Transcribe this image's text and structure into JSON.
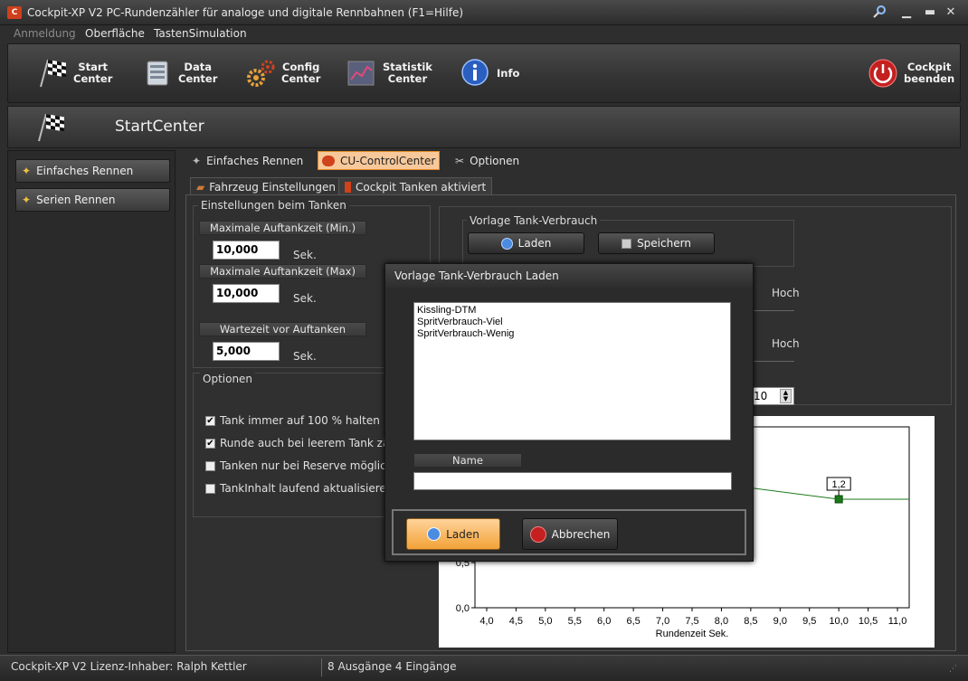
{
  "window": {
    "title": "Cockpit-XP V2 PC-Rundenzähler für analoge und digitale Rennbahnen (F1=Hilfe)",
    "app_icon": "app-logo-icon",
    "controls": [
      "minimize",
      "maximize",
      "close"
    ]
  },
  "menu": [
    {
      "label": "Anmeldung",
      "disabled": true
    },
    {
      "label": "Oberfläche"
    },
    {
      "label": "TastenSimulation"
    }
  ],
  "toolbar": {
    "items": [
      {
        "label": "Start\nCenter",
        "icon": "checkered-flag-icon"
      },
      {
        "label": "Data\nCenter",
        "icon": "database-icon"
      },
      {
        "label": "Config\nCenter",
        "icon": "gears-icon"
      },
      {
        "label": "Statistik\nCenter",
        "icon": "statistics-icon"
      },
      {
        "label": "Info",
        "icon": "info-icon"
      }
    ],
    "exit": {
      "label": "Cockpit\nbeenden",
      "icon": "power-icon"
    }
  },
  "subheader": {
    "title": "StartCenter"
  },
  "sidebar": {
    "items": [
      {
        "label": "Einfaches Rennen"
      },
      {
        "label": "Serien Rennen"
      }
    ]
  },
  "tabs_top": [
    {
      "label": "Einfaches Rennen"
    },
    {
      "label": "CU-ControlCenter",
      "active": true
    },
    {
      "label": "Optionen"
    }
  ],
  "tabs_sub": [
    {
      "label": "Fahrzeug Einstellungen"
    },
    {
      "label": "Cockpit Tanken aktiviert",
      "active": true
    }
  ],
  "tanken": {
    "group_title": "Einstellungen beim Tanken",
    "max_min_label": "Maximale Auftankzeit (Min.)",
    "max_min_value": "10,000",
    "max_max_label": "Maximale Auftankzeit (Max)",
    "max_max_value": "10,000",
    "wait_label": "Wartezeit vor Auftanken",
    "wait_value": "5,000",
    "unit": "Sek."
  },
  "options": {
    "group_title": "Optionen",
    "items": [
      {
        "label": "Tank immer auf 100 % halten",
        "checked": true
      },
      {
        "label": "Runde auch bei leerem Tank zä",
        "checked": true
      },
      {
        "label": "Tanken nur bei Reserve möglich",
        "checked": false
      },
      {
        "label": "TankInhalt laufend aktualisierer",
        "checked": false
      }
    ]
  },
  "vorlage": {
    "group_title": "Vorlage Tank-Verbrauch",
    "load_label": "Laden",
    "save_label": "Speichern"
  },
  "right_labels": {
    "hoch1": "Hoch",
    "hoch2": "Hoch",
    "spin_value": "10"
  },
  "chart_data": {
    "type": "line",
    "xlabel": "Rundenzeit Sek.",
    "ylabel": "",
    "x_ticks": [
      "4,0",
      "4,5",
      "5,0",
      "5,5",
      "6,0",
      "6,5",
      "7,0",
      "7,5",
      "8,0",
      "8,5",
      "9,0",
      "9,5",
      "10,0",
      "10,5",
      "11,0"
    ],
    "y_ticks": [
      "0,0",
      "0,5"
    ],
    "xlim": [
      3.8,
      11.2
    ],
    "ylim": [
      0,
      2.0
    ],
    "series": [
      {
        "x": [
          7.0,
          10.0,
          11.2
        ],
        "y": [
          1.45,
          1.2,
          1.2
        ]
      }
    ],
    "point_label": "1,2",
    "point": {
      "x": 10.0,
      "y": 1.2
    },
    "colors": {
      "line": "#1a7a1a"
    }
  },
  "dialog": {
    "title": "Vorlage Tank-Verbrauch  Laden",
    "list": [
      "Kissling-DTM",
      "SpritVerbrauch-Viel",
      "SpritVerbrauch-Wenig"
    ],
    "name_label": "Name",
    "name_value": "",
    "ok_label": "Laden",
    "cancel_label": "Abbrechen"
  },
  "status": {
    "license": "Cockpit-XP V2 Lizenz-Inhaber: Ralph Kettler",
    "io": "8 Ausgänge 4 Eingänge"
  },
  "colors": {
    "accent": "#f2a238",
    "active_tab_bg": "#f7c89a",
    "chart_line": "#1a7a1a"
  }
}
